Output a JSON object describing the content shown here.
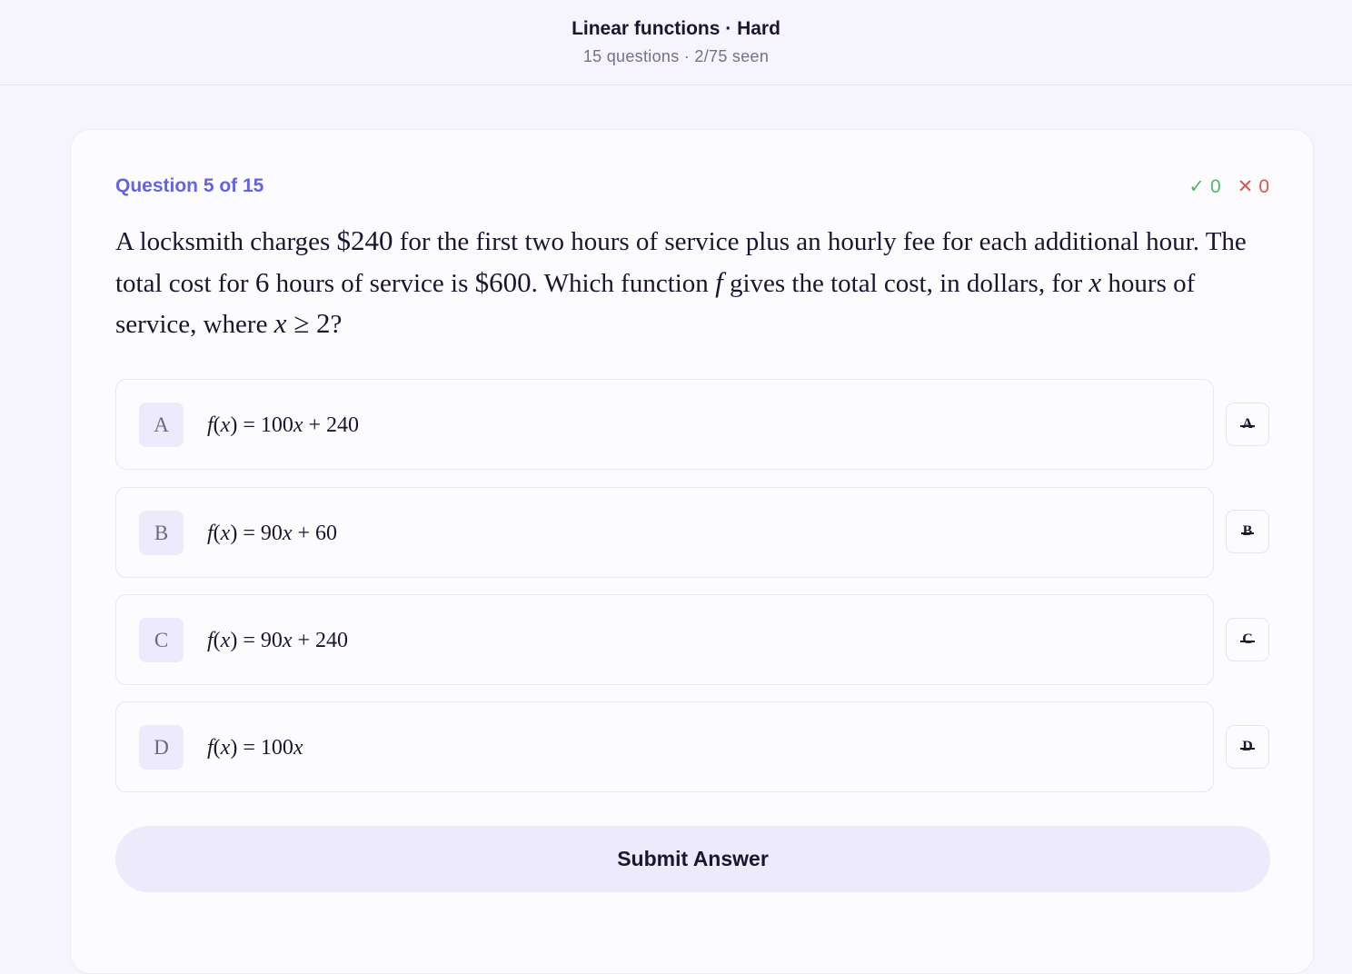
{
  "header": {
    "title": "Linear functions · Hard",
    "subtitle": "15 questions · 2/75 seen"
  },
  "question": {
    "number_label": "Question 5 of 15",
    "score": {
      "correct_icon": "✓",
      "correct": "0",
      "wrong_icon": "✕",
      "wrong": "0"
    },
    "stem": {
      "t1": "A locksmith charges ",
      "m1": "$240",
      "t2": " for the first two hours of service plus an hourly fee for each additional hour. The total cost for ",
      "m2": "6",
      "t3": " hours of service is ",
      "m3": "$600",
      "t4": ". Which function ",
      "m4": "f",
      "t5": " gives the total cost, in dollars, for ",
      "m5": "x",
      "t6": " hours of service, where ",
      "m6": "x",
      "m7": " ≥ 2",
      "t7": "?"
    }
  },
  "options": [
    {
      "letter": "A",
      "formula": "100x + 240"
    },
    {
      "letter": "B",
      "formula": "90x + 60"
    },
    {
      "letter": "C",
      "formula": "90x + 240"
    },
    {
      "letter": "D",
      "formula": "100x"
    }
  ],
  "submit_label": "Submit Answer"
}
